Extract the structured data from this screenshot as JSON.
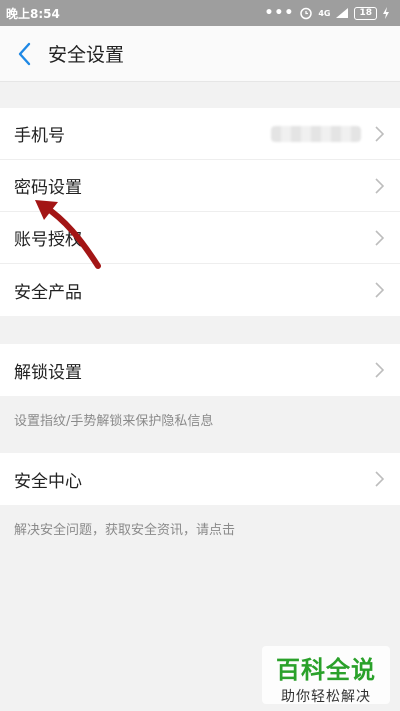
{
  "status_bar": {
    "time": "晚上8:54",
    "signal": "4G",
    "battery": "18"
  },
  "nav": {
    "title": "安全设置"
  },
  "group1": {
    "rows": [
      "手机号",
      "密码设置",
      "账号授权",
      "安全产品"
    ]
  },
  "group2": {
    "row": "解锁设置",
    "hint": "设置指纹/手势解锁来保护隐私信息"
  },
  "group3": {
    "row": "安全中心",
    "hint": "解决安全问题，获取安全资讯，请点击"
  },
  "watermark": {
    "title": "百科全说",
    "subtitle": "助你轻松解决"
  },
  "colors": {
    "accent": "#1e88e5",
    "annotation_arrow": "#a31515",
    "watermark_green": "#2aa12a"
  },
  "icons": [
    "back-arrow-icon",
    "chevron-right-icon",
    "alarm-icon",
    "battery-icon"
  ]
}
